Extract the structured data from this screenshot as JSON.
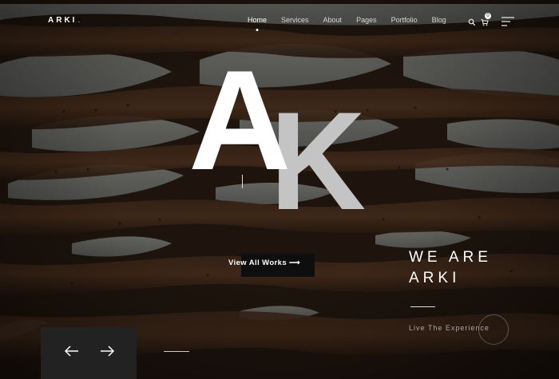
{
  "brand": {
    "name": "ARKI",
    "dot": "."
  },
  "nav": {
    "items": [
      {
        "label": "Home",
        "active": true
      },
      {
        "label": "Services"
      },
      {
        "label": "About"
      },
      {
        "label": "Pages"
      },
      {
        "label": "Portfolio"
      },
      {
        "label": "Blog"
      }
    ]
  },
  "header_icons": {
    "search": "search-icon",
    "cart": "cart-icon",
    "menu": "menu-icon",
    "cart_count": "0"
  },
  "hero": {
    "letter_primary": "A",
    "letter_secondary": "K",
    "cta_label": "View All Works ⟶",
    "tagline_line1": "WE ARE",
    "tagline_line2": "ARKI",
    "subtagline": "Live The Experience"
  },
  "slider": {
    "prev_icon": "arrow-left-icon",
    "next_icon": "arrow-right-icon"
  },
  "colors": {
    "background": "#2a1c12",
    "letter_primary": "#ffffff",
    "letter_secondary": "#c4c4c4",
    "cta_bg": "#0e0e0e"
  }
}
